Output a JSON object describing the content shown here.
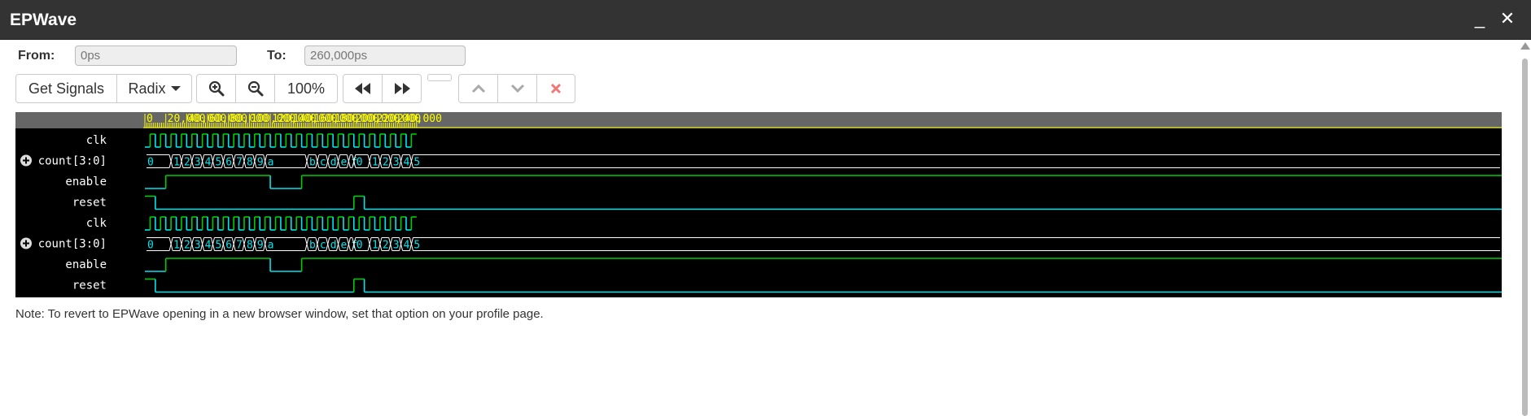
{
  "window": {
    "title": "EPWave",
    "minimize_glyph": "_",
    "close_glyph": "✕"
  },
  "range": {
    "from_label": "From:",
    "from_value": "0ps",
    "to_label": "To:",
    "to_value": "260,000ps"
  },
  "toolbar": {
    "get_signals": "Get Signals",
    "radix": "Radix",
    "zoom_level": "100%"
  },
  "waveform": {
    "axis_labels": [
      "0",
      "20,000",
      "40,000",
      "60,000",
      "80,000",
      "100,000",
      "120,000",
      "140,000",
      "160,000",
      "180,000",
      "200,000",
      "220,000",
      "240,000"
    ],
    "time_end": 260000,
    "clk_half_period": 5000,
    "signals": [
      {
        "name": "clk",
        "kind": "clock",
        "expandable": false
      },
      {
        "name": "count[3:0]",
        "kind": "bus",
        "expandable": true,
        "changes": [
          {
            "t": 0,
            "v": "0"
          },
          {
            "t": 25000,
            "v": "1"
          },
          {
            "t": 35000,
            "v": "2"
          },
          {
            "t": 45000,
            "v": "3"
          },
          {
            "t": 55000,
            "v": "4"
          },
          {
            "t": 65000,
            "v": "5"
          },
          {
            "t": 75000,
            "v": "6"
          },
          {
            "t": 85000,
            "v": "7"
          },
          {
            "t": 95000,
            "v": "8"
          },
          {
            "t": 105000,
            "v": "9"
          },
          {
            "t": 115000,
            "v": "a"
          },
          {
            "t": 155000,
            "v": "b"
          },
          {
            "t": 165000,
            "v": "c"
          },
          {
            "t": 175000,
            "v": "d"
          },
          {
            "t": 185000,
            "v": "e"
          },
          {
            "t": 195000,
            "v": "f"
          },
          {
            "t": 200000,
            "v": "0"
          },
          {
            "t": 215000,
            "v": "1"
          },
          {
            "t": 225000,
            "v": "2"
          },
          {
            "t": 235000,
            "v": "3"
          },
          {
            "t": 245000,
            "v": "4"
          },
          {
            "t": 255000,
            "v": "5"
          }
        ]
      },
      {
        "name": "enable",
        "kind": "bit",
        "expandable": false,
        "changes": [
          {
            "t": 0,
            "v": 0
          },
          {
            "t": 20000,
            "v": 1
          },
          {
            "t": 120000,
            "v": 0
          },
          {
            "t": 150000,
            "v": 1
          }
        ]
      },
      {
        "name": "reset",
        "kind": "bit",
        "expandable": false,
        "changes": [
          {
            "t": 0,
            "v": 1
          },
          {
            "t": 10000,
            "v": 0
          },
          {
            "t": 200000,
            "v": 1
          },
          {
            "t": 210000,
            "v": 0
          }
        ]
      },
      {
        "name": "clk",
        "kind": "clock",
        "expandable": false
      },
      {
        "name": "count[3:0]",
        "kind": "bus",
        "expandable": true,
        "changes": [
          {
            "t": 0,
            "v": "0"
          },
          {
            "t": 25000,
            "v": "1"
          },
          {
            "t": 35000,
            "v": "2"
          },
          {
            "t": 45000,
            "v": "3"
          },
          {
            "t": 55000,
            "v": "4"
          },
          {
            "t": 65000,
            "v": "5"
          },
          {
            "t": 75000,
            "v": "6"
          },
          {
            "t": 85000,
            "v": "7"
          },
          {
            "t": 95000,
            "v": "8"
          },
          {
            "t": 105000,
            "v": "9"
          },
          {
            "t": 115000,
            "v": "a"
          },
          {
            "t": 155000,
            "v": "b"
          },
          {
            "t": 165000,
            "v": "c"
          },
          {
            "t": 175000,
            "v": "d"
          },
          {
            "t": 185000,
            "v": "e"
          },
          {
            "t": 195000,
            "v": "f"
          },
          {
            "t": 200000,
            "v": "0"
          },
          {
            "t": 215000,
            "v": "1"
          },
          {
            "t": 225000,
            "v": "2"
          },
          {
            "t": 235000,
            "v": "3"
          },
          {
            "t": 245000,
            "v": "4"
          },
          {
            "t": 255000,
            "v": "5"
          }
        ]
      },
      {
        "name": "enable",
        "kind": "bit",
        "expandable": false,
        "changes": [
          {
            "t": 0,
            "v": 0
          },
          {
            "t": 20000,
            "v": 1
          },
          {
            "t": 120000,
            "v": 0
          },
          {
            "t": 150000,
            "v": 1
          }
        ]
      },
      {
        "name": "reset",
        "kind": "bit",
        "expandable": false,
        "changes": [
          {
            "t": 0,
            "v": 1
          },
          {
            "t": 10000,
            "v": 0
          },
          {
            "t": 200000,
            "v": 1
          },
          {
            "t": 210000,
            "v": 0
          }
        ]
      }
    ],
    "colors": {
      "background": "#000000",
      "ruler": "#666666",
      "ruler_text": "#ffff00",
      "high": "#00cc00",
      "low": "#00e5ee",
      "bus_line": "#ffffff",
      "bus_text": "#00e5ee",
      "name_text": "#ffffff"
    }
  },
  "note": "Note: To revert to EPWave opening in a new browser window, set that option on your profile page."
}
